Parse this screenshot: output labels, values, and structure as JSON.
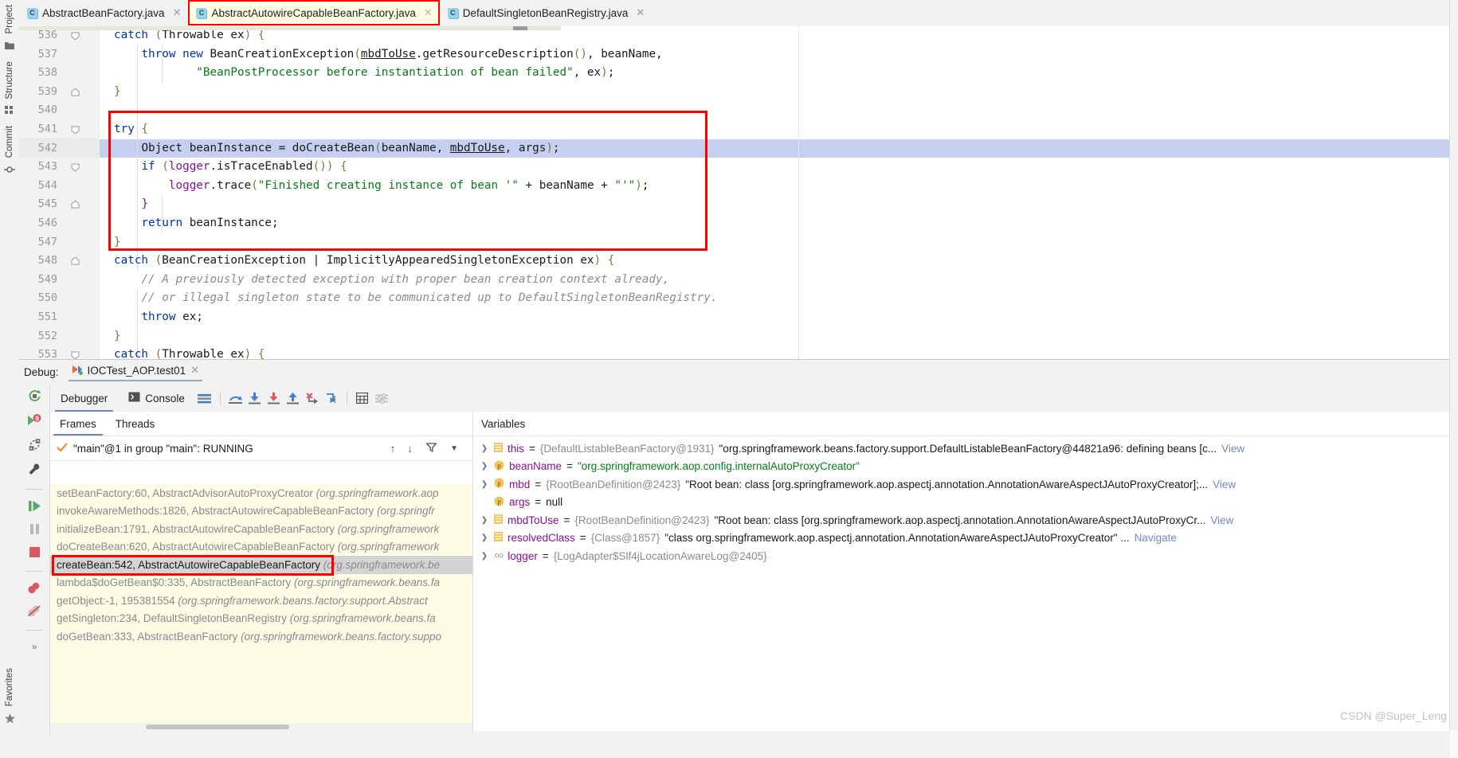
{
  "rail": {
    "top_items": [
      {
        "label": "Project",
        "icon": "folder-icon"
      },
      {
        "label": "Structure",
        "icon": "structure-icon"
      },
      {
        "label": "Commit",
        "icon": "commit-icon"
      }
    ],
    "bottom_items": [
      {
        "label": "Favorites",
        "icon": "star-icon"
      }
    ]
  },
  "editor_tabs": [
    {
      "label": "AbstractBeanFactory.java",
      "icon": "java-class-icon",
      "active": false,
      "highlighted": false
    },
    {
      "label": "AbstractAutowireCapableBeanFactory.java",
      "icon": "java-class-icon",
      "active": true,
      "highlighted": true
    },
    {
      "label": "DefaultSingletonBeanRegistry.java",
      "icon": "java-class-icon",
      "active": false,
      "highlighted": false
    }
  ],
  "editor": {
    "first_line_number": 536,
    "current_line": 542,
    "lines": [
      {
        "n": 536,
        "text": "catch (Throwable ex) {"
      },
      {
        "n": 537,
        "text": "    throw new BeanCreationException(mbdToUse.getResourceDescription(), beanName,"
      },
      {
        "n": 538,
        "text": "            \"BeanPostProcessor before instantiation of bean failed\", ex);"
      },
      {
        "n": 539,
        "text": "}"
      },
      {
        "n": 540,
        "text": ""
      },
      {
        "n": 541,
        "text": "try {"
      },
      {
        "n": 542,
        "text": "    Object beanInstance = doCreateBean(beanName, mbdToUse, args);"
      },
      {
        "n": 543,
        "text": "    if (logger.isTraceEnabled()) {"
      },
      {
        "n": 544,
        "text": "        logger.trace(\"Finished creating instance of bean '\" + beanName + \"'\");"
      },
      {
        "n": 545,
        "text": "    }"
      },
      {
        "n": 546,
        "text": "    return beanInstance;"
      },
      {
        "n": 547,
        "text": "}"
      },
      {
        "n": 548,
        "text": "catch (BeanCreationException | ImplicitlyAppearedSingletonException ex) {"
      },
      {
        "n": 549,
        "text": "    // A previously detected exception with proper bean creation context already,"
      },
      {
        "n": 550,
        "text": "    // or illegal singleton state to be communicated up to DefaultSingletonBeanRegistry."
      },
      {
        "n": 551,
        "text": "    throw ex;"
      },
      {
        "n": 552,
        "text": "}"
      },
      {
        "n": 553,
        "text": "catch (Throwable ex) {"
      }
    ]
  },
  "debug": {
    "label": "Debug:",
    "run_config": "IOCTest_AOP.test01",
    "tabs": [
      {
        "label": "Debugger",
        "icon": "debugger-icon",
        "active": true
      },
      {
        "label": "Console",
        "icon": "console-icon",
        "active": false
      }
    ],
    "toolbar_icons": [
      "layout-icon",
      "step-over-icon",
      "step-into-icon",
      "force-step-into-icon",
      "step-out-icon",
      "drop-frame-icon",
      "run-to-cursor-icon",
      "evaluate-expression-icon",
      "mute-breakpoints-icon"
    ],
    "side_icons": [
      "rerun-icon",
      "rerun-failed-icon",
      "restart-icon",
      "settings-icon",
      "resume-icon",
      "pause-icon",
      "stop-icon",
      "breakpoints-icon",
      "mute-breakpoints-icon",
      "more-icon"
    ],
    "sub_tabs": [
      {
        "label": "Frames",
        "active": true
      },
      {
        "label": "Threads",
        "active": false
      }
    ],
    "thread_row": {
      "status_icon": "check-icon",
      "text": "\"main\"@1 in group \"main\": RUNNING",
      "actions": [
        "arrow-up-icon",
        "arrow-down-icon",
        "filter-icon",
        "chevron-down-icon"
      ]
    },
    "frames": [
      {
        "method": "setBeanFactory:60, AbstractAdvisorAutoProxyCreator",
        "pkg": "(org.springframework.aop",
        "selected": false
      },
      {
        "method": "invokeAwareMethods:1826, AbstractAutowireCapableBeanFactory",
        "pkg": "(org.springfr",
        "selected": false
      },
      {
        "method": "initializeBean:1791, AbstractAutowireCapableBeanFactory",
        "pkg": "(org.springframework",
        "selected": false
      },
      {
        "method": "doCreateBean:620, AbstractAutowireCapableBeanFactory",
        "pkg": "(org.springframework",
        "selected": false
      },
      {
        "method": "createBean:542, AbstractAutowireCapableBeanFactory",
        "pkg": "(org.springframework.be",
        "selected": true
      },
      {
        "method": "lambda$doGetBean$0:335, AbstractBeanFactory",
        "pkg": "(org.springframework.beans.fa",
        "selected": false
      },
      {
        "method": "getObject:-1, 195381554",
        "pkg": "(org.springframework.beans.factory.support.Abstract",
        "selected": false
      },
      {
        "method": "getSingleton:234, DefaultSingletonBeanRegistry",
        "pkg": "(org.springframework.beans.fa",
        "selected": false
      },
      {
        "method": "doGetBean:333, AbstractBeanFactory",
        "pkg": "(org.springframework.beans.factory.suppo",
        "selected": false
      }
    ],
    "variables_header": "Variables",
    "variables": [
      {
        "expandable": true,
        "icon": "object-icon",
        "name": "this",
        "eq": " = ",
        "ref": "{DefaultListableBeanFactory@1931}",
        "value": "\"org.springframework.beans.factory.support.DefaultListableBeanFactory@44821a96: defining beans [c...",
        "value_kind": "text",
        "link": "View"
      },
      {
        "expandable": true,
        "icon": "param-icon",
        "name": "beanName",
        "eq": " = ",
        "ref": "",
        "value": "\"org.springframework.aop.config.internalAutoProxyCreator\"",
        "value_kind": "string",
        "link": ""
      },
      {
        "expandable": true,
        "icon": "param-icon",
        "name": "mbd",
        "eq": " = ",
        "ref": "{RootBeanDefinition@2423}",
        "value": "\"Root bean: class [org.springframework.aop.aspectj.annotation.AnnotationAwareAspectJAutoProxyCreator];...",
        "value_kind": "text",
        "link": "View"
      },
      {
        "expandable": false,
        "icon": "param-icon",
        "name": "args",
        "eq": " = ",
        "ref": "",
        "value": "null",
        "value_kind": "null",
        "link": ""
      },
      {
        "expandable": true,
        "icon": "object-icon",
        "name": "mbdToUse",
        "eq": " = ",
        "ref": "{RootBeanDefinition@2423}",
        "value": "\"Root bean: class [org.springframework.aop.aspectj.annotation.AnnotationAwareAspectJAutoProxyCr...",
        "value_kind": "text",
        "link": "View"
      },
      {
        "expandable": true,
        "icon": "object-icon",
        "name": "resolvedClass",
        "eq": " = ",
        "ref": "{Class@1857}",
        "value": "\"class org.springframework.aop.aspectj.annotation.AnnotationAwareAspectJAutoProxyCreator\" ...",
        "value_kind": "text",
        "link": "Navigate"
      },
      {
        "expandable": true,
        "icon": "field-icon",
        "name": "logger",
        "eq": " = ",
        "ref": "{LogAdapter$Slf4jLocationAwareLog@2405}",
        "value": "",
        "value_kind": "text",
        "link": ""
      }
    ]
  },
  "watermark": "CSDN @Super_Leng",
  "colors": {
    "highlight_box": "#ff0000",
    "current_line": "#c5cfef",
    "frames_bg": "#fdfde6",
    "selected_frame": "#d4d4d4",
    "accent_blue": "#6c86c0",
    "keyword": "#0033b3",
    "string": "#067d17",
    "comment": "#8c8c8c",
    "purple": "#871094"
  }
}
